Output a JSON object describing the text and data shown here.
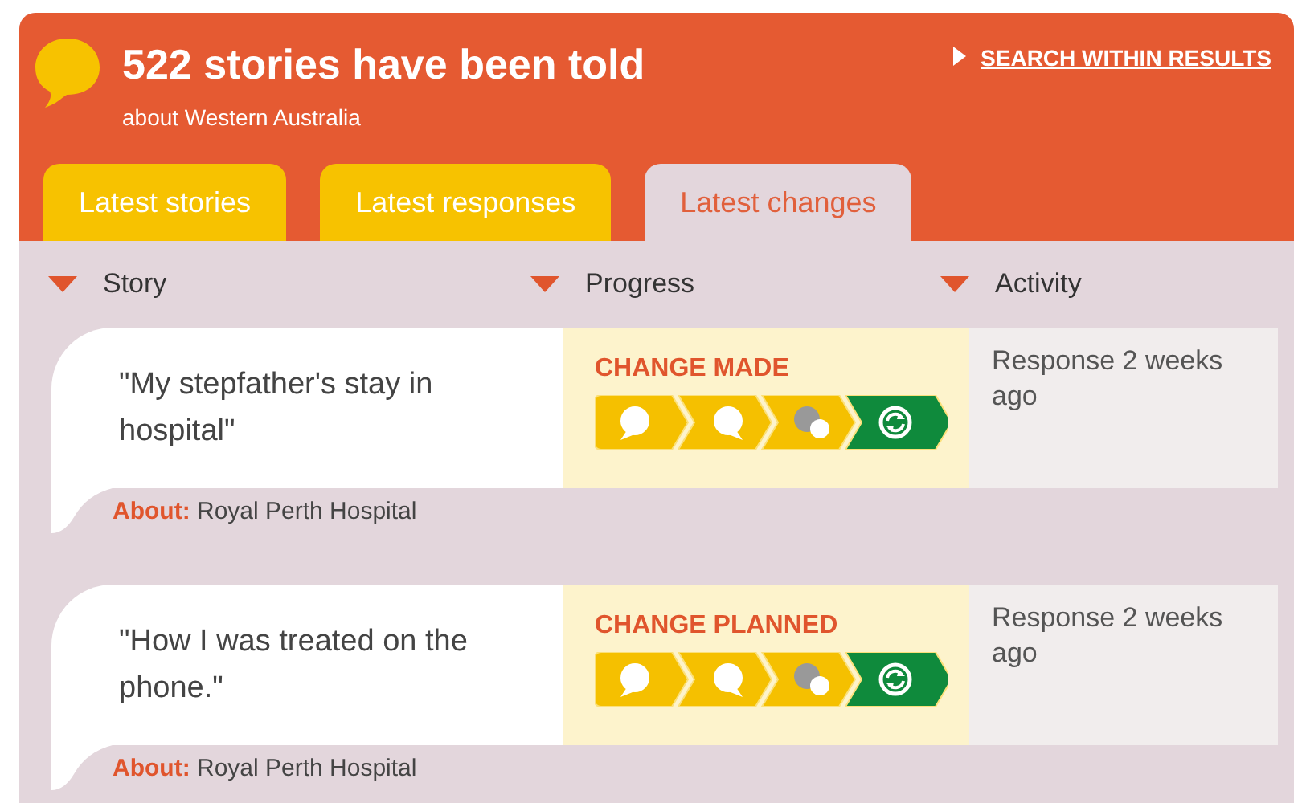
{
  "header": {
    "title": "522 stories have been told",
    "subtitle": "about Western Australia",
    "search_link": "SEARCH WITHIN RESULTS"
  },
  "tabs": [
    {
      "label": "Latest stories",
      "selected": false
    },
    {
      "label": "Latest responses",
      "selected": false
    },
    {
      "label": "Latest changes",
      "selected": true
    }
  ],
  "columns": [
    "Story",
    "Progress",
    "Activity"
  ],
  "rows": [
    {
      "story": "\"My stepfather's stay in hospital\"",
      "about_label": "About:",
      "about": "Royal Perth Hospital",
      "status": "CHANGE MADE",
      "activity": "Response 2 weeks ago",
      "stages": [
        {
          "kind": "story",
          "color": "#f5c000"
        },
        {
          "kind": "response",
          "color": "#f5c000"
        },
        {
          "kind": "discussion",
          "color": "#f5c000"
        },
        {
          "kind": "change",
          "color": "#0f8a3c"
        }
      ]
    },
    {
      "story": "\"How I was treated on the phone.\"",
      "about_label": "About:",
      "about": "Royal Perth Hospital",
      "status": "CHANGE PLANNED",
      "activity": "Response 2 weeks ago",
      "stages": [
        {
          "kind": "story",
          "color": "#f5c000"
        },
        {
          "kind": "response",
          "color": "#f5c000"
        },
        {
          "kind": "discussion",
          "color": "#f5c000"
        },
        {
          "kind": "change",
          "color": "#0f8a3c"
        }
      ]
    }
  ]
}
